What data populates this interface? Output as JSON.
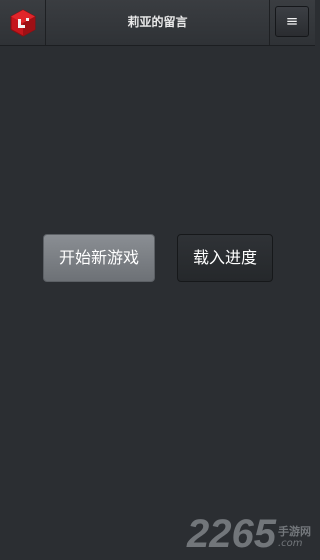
{
  "header": {
    "title": "莉亚的留言",
    "logo_icon": "red-cube-logo-icon",
    "menu_icon": "hamburger-menu-icon",
    "menu_glyph": "≡"
  },
  "main": {
    "new_game_label": "开始新游戏",
    "load_progress_label": "载入进度"
  },
  "watermark": {
    "big": "2265",
    "small": "手游网",
    "com": ".com"
  },
  "colors": {
    "background": "#2b2e32",
    "logo_red": "#c4161c",
    "primary_button": "#7d8186"
  }
}
